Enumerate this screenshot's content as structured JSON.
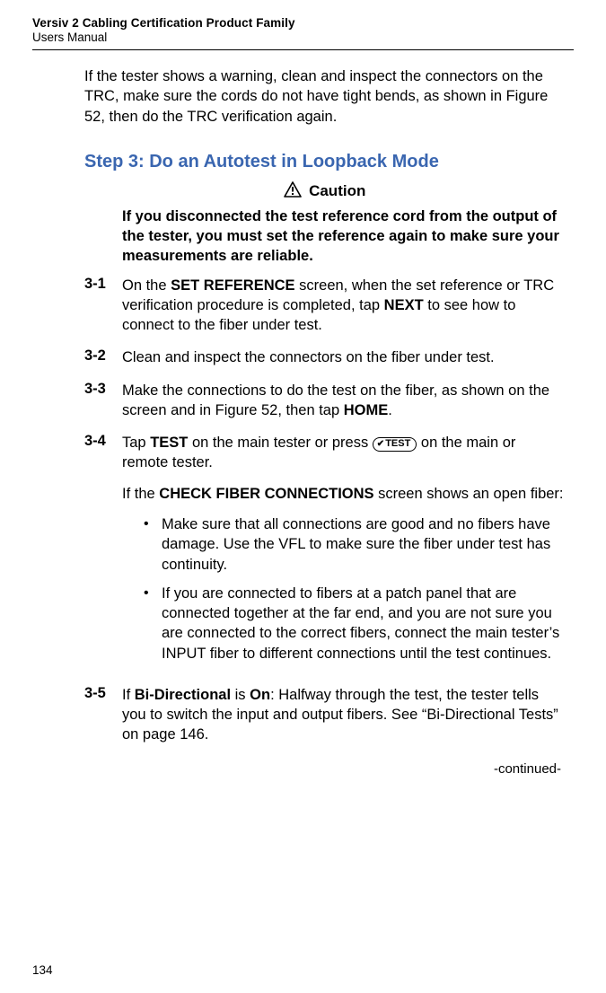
{
  "header": {
    "line1": "Versiv 2 Cabling Certification Product Family",
    "line2": "Users Manual"
  },
  "intro": "If the tester shows a warning, clean and inspect the connectors on the TRC, make sure the cords do not have tight bends, as shown in Figure 52, then do the TRC verification again.",
  "heading": "Step 3: Do an Autotest in Loopback Mode",
  "caution": {
    "label": "Caution",
    "text": "If you disconnected the test reference cord from the output of the tester, you must set the reference again to make sure your measurements are reliable."
  },
  "steps": {
    "s31": {
      "num": "3-1",
      "pre": "On the ",
      "bold1": "SET REFERENCE",
      "mid": " screen, when the set reference or TRC verification procedure is completed, tap ",
      "bold2": "NEXT",
      "post": " to see how to connect to the fiber under test."
    },
    "s32": {
      "num": "3-2",
      "text": "Clean and inspect the connectors on the fiber under test."
    },
    "s33": {
      "num": "3-3",
      "pre": "Make the connections to do the test on the fiber, as shown on the screen and in Figure 52, then tap ",
      "bold1": "HOME",
      "post": "."
    },
    "s34": {
      "num": "3-4",
      "p1_pre": "Tap ",
      "p1_bold": "TEST",
      "p1_mid": " on the main tester or press ",
      "btn": "TEST",
      "p1_post": " on the main or remote tester.",
      "p2_pre": "If the ",
      "p2_bold": "CHECK FIBER CONNECTIONS",
      "p2_post": " screen shows an open fiber:",
      "b1": "Make sure that all connections are good and no fibers have damage. Use the VFL to make sure the fiber under test has continuity.",
      "b2": "If you are connected to fibers at a patch panel that are connected together at the far end, and you are not sure you are connected to the correct fibers, connect the main tester’s INPUT fiber to different connections until the test continues."
    },
    "s35": {
      "num": "3-5",
      "pre": "If ",
      "bold1": "Bi-Directional",
      "mid1": " is ",
      "bold2": "On",
      "post": ": Halfway through the test, the tester tells you to switch the input and output fibers. See “Bi-Directional Tests” on page 146."
    }
  },
  "continued": "-continued-",
  "pageNumber": "134"
}
